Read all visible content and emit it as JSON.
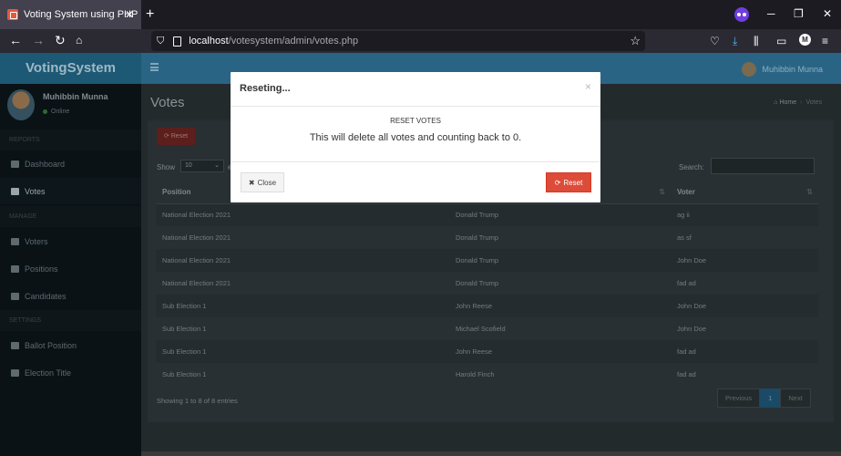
{
  "browser": {
    "tab_title": "Voting System using PHP",
    "tab_close": "✕",
    "new_tab": "+",
    "url_host": "localhost",
    "url_path": "/votesystem/admin/votes.php",
    "win_min": "─",
    "win_restore": "❐",
    "win_close": "✕",
    "profile_letter": "M"
  },
  "app": {
    "logo_bold": "Voting",
    "logo_rest": "System",
    "top_user": "Muhibbin Munna"
  },
  "sidebar": {
    "user_name": "Muhibbin Munna",
    "user_status": "Online",
    "header_reports": "REPORTS",
    "header_manage": "MANAGE",
    "header_settings": "SETTINGS",
    "items": [
      {
        "label": "Dashboard"
      },
      {
        "label": "Votes"
      },
      {
        "label": "Voters"
      },
      {
        "label": "Positions"
      },
      {
        "label": "Candidates"
      },
      {
        "label": "Ballot Position"
      },
      {
        "label": "Election Title"
      }
    ]
  },
  "page": {
    "title": "Votes",
    "breadcrumb_home": "Home",
    "breadcrumb_current": "Votes",
    "reset_label": "Reset",
    "show_label": "Show",
    "show_value": "10",
    "show_suffix": "e",
    "search_label": "Search:"
  },
  "table": {
    "headers": [
      "Position",
      "",
      "Voter"
    ],
    "rows": [
      [
        "National Election 2021",
        "Donald Trump",
        "ag ii"
      ],
      [
        "National Election 2021",
        "Donald Trump",
        "as sf"
      ],
      [
        "National Election 2021",
        "Donald Trump",
        "John Doe"
      ],
      [
        "National Election 2021",
        "Donald Trump",
        "fad ad"
      ],
      [
        "Sub Election 1",
        "John Reese",
        "John Doe"
      ],
      [
        "Sub Election 1",
        "Michael Scofield",
        "John Doe"
      ],
      [
        "Sub Election 1",
        "John Reese",
        "fad ad"
      ],
      [
        "Sub Election 1",
        "Harold Finch",
        "fad ad"
      ]
    ],
    "info": "Showing 1 to 8 of 8 entries",
    "pager": {
      "prev": "Previous",
      "page": "1",
      "next": "Next"
    }
  },
  "modal": {
    "title": "Reseting...",
    "close_x": "×",
    "sub": "RESET VOTES",
    "message": "This will delete all votes and counting back to 0.",
    "close_label": "Close",
    "reset_label": "Reset"
  },
  "colors": {
    "danger": "#dd4b39",
    "primary": "#2a6485"
  }
}
